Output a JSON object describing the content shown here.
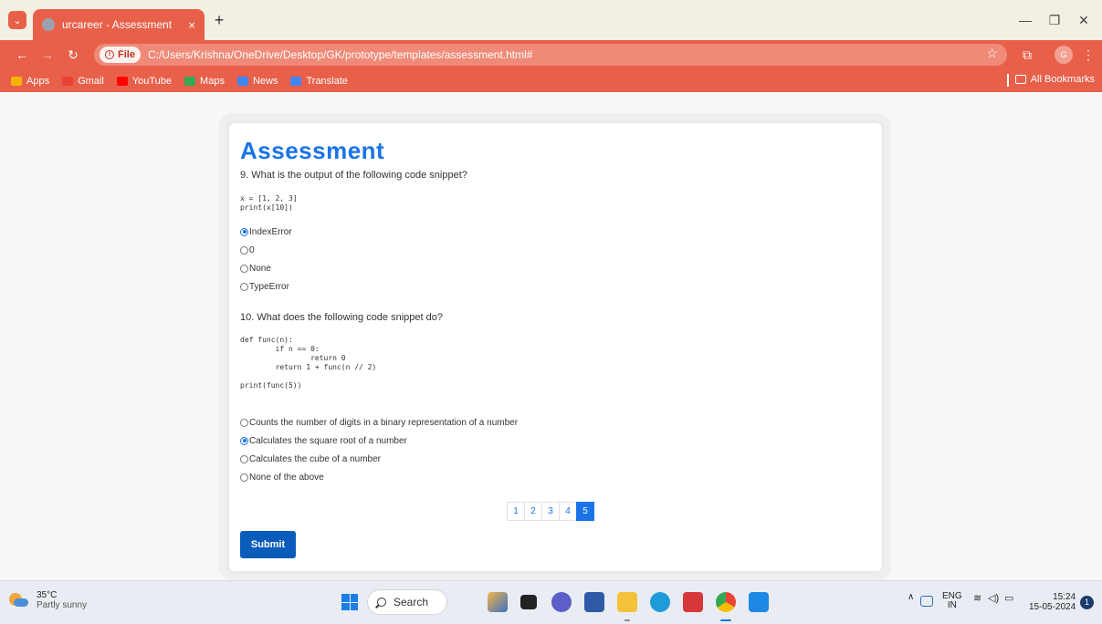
{
  "browser": {
    "tab_title": "urcareer - Assessment",
    "tab_close": "×",
    "new_tab": "+",
    "file_chip": "File",
    "url": "C:/Users/Krishna/OneDrive/Desktop/GK/prototype/templates/assessment.html#",
    "bookmarks": [
      {
        "label": "Apps",
        "icon": "apps-grid-icon",
        "color": "#f4b400"
      },
      {
        "label": "Gmail",
        "icon": "gmail-icon",
        "color": "#ea4335"
      },
      {
        "label": "YouTube",
        "icon": "youtube-icon",
        "color": "#ff0000"
      },
      {
        "label": "Maps",
        "icon": "maps-icon",
        "color": "#34a853"
      },
      {
        "label": "News",
        "icon": "news-icon",
        "color": "#4285f4"
      },
      {
        "label": "Translate",
        "icon": "translate-icon",
        "color": "#4285f4"
      }
    ],
    "all_bookmarks": "All Bookmarks",
    "profile_initial": "G",
    "theme_color": "#e8604a"
  },
  "page": {
    "heading": "Assessment",
    "accent_color": "#1a73e8",
    "questions": [
      {
        "text": "9. What is the output of the following code snippet?",
        "code": "x = [1, 2, 3]\nprint(x[10])",
        "options": [
          {
            "label": "IndexError",
            "selected": true
          },
          {
            "label": "0",
            "selected": false
          },
          {
            "label": "None",
            "selected": false
          },
          {
            "label": "TypeError",
            "selected": false
          }
        ]
      },
      {
        "text": "10. What does the following code snippet do?",
        "code": "def func(n):\n        if n == 0:\n                return 0\n        return 1 + func(n // 2)\n\nprint(func(5))",
        "options": [
          {
            "label": "Counts the number of digits in a binary representation of a number",
            "selected": false
          },
          {
            "label": "Calculates the square root of a number",
            "selected": true
          },
          {
            "label": "Calculates the cube of a number",
            "selected": false
          },
          {
            "label": "None of the above",
            "selected": false
          }
        ]
      }
    ],
    "pagination": {
      "pages": [
        "1",
        "2",
        "3",
        "4",
        "5"
      ],
      "current": "5"
    },
    "submit_label": "Submit"
  },
  "taskbar": {
    "weather_temp": "35°C",
    "weather_desc": "Partly sunny",
    "search_label": "Search",
    "lang_top": "ENG",
    "lang_bottom": "IN",
    "time": "15:24",
    "date": "15-05-2024",
    "notification_count": "1"
  }
}
